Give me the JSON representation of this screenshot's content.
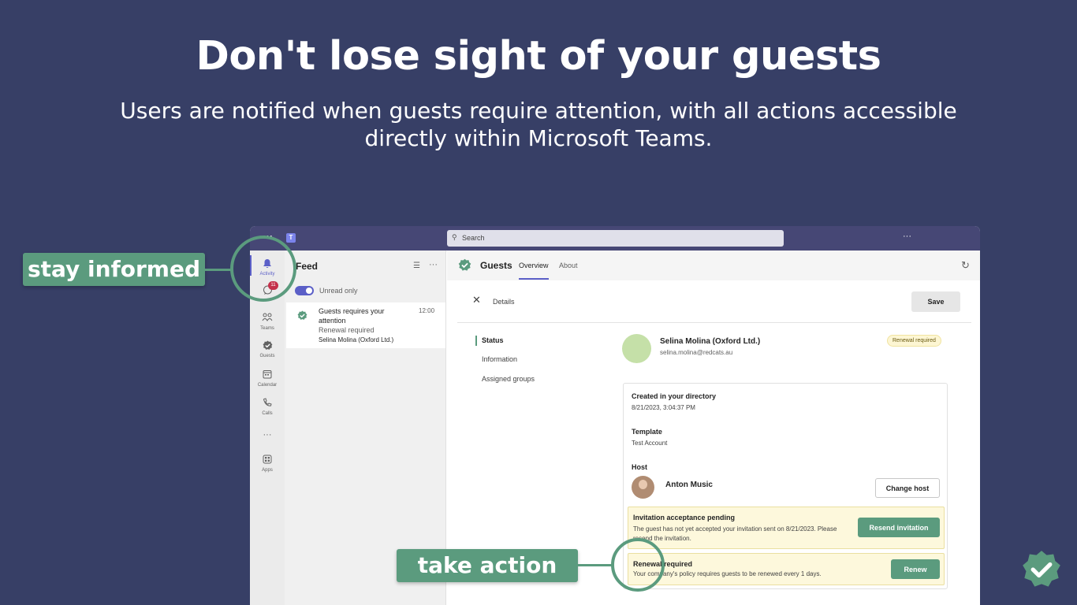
{
  "headline": "Don't lose sight of your guests",
  "subline": "Users are notified when guests require attention, with all actions accessible directly within Microsoft Teams.",
  "callouts": {
    "stay_informed": "stay informed",
    "take_action": "take action"
  },
  "titlebar": {
    "more_label": "⋯",
    "apps_dots": "⋯",
    "logo_text": "T",
    "search_placeholder": "Search",
    "search_icon": "search-icon",
    "overflow": "···"
  },
  "rail": {
    "items": [
      {
        "label": "Activity",
        "icon": "bell-icon"
      },
      {
        "label": "",
        "icon": "chat-icon",
        "badge": "11"
      },
      {
        "label": "Teams",
        "icon": "teams-icon"
      },
      {
        "label": "Guests",
        "icon": "guests-icon"
      },
      {
        "label": "Calendar",
        "icon": "calendar-icon"
      },
      {
        "label": "Calls",
        "icon": "phone-icon"
      },
      {
        "label": "···",
        "icon": "more-icon"
      },
      {
        "label": "Apps",
        "icon": "apps-icon"
      }
    ]
  },
  "feed": {
    "title": "Feed",
    "toggle_label": "Unread only",
    "card": {
      "title": "Guests requires your attention",
      "time": "12:00",
      "subtitle": "Renewal required",
      "name": "Selina Molina (Oxford Ltd.)"
    }
  },
  "app": {
    "name": "Guests",
    "tabs": [
      "Overview",
      "About"
    ],
    "details_label": "Details",
    "save_label": "Save",
    "nav": [
      "Status",
      "Information",
      "Assigned groups"
    ],
    "guest": {
      "name": "Selina Molina (Oxford Ltd.)",
      "email": "selina.molina@redcats.au",
      "status_badge": "Renewal required"
    },
    "card": {
      "created_label": "Created in your directory",
      "created_value": "8/21/2023, 3:04:37 PM",
      "template_label": "Template",
      "template_value": "Test Account",
      "host_label": "Host",
      "host_name": "Anton Music",
      "change_host": "Change host",
      "alert1_title": "Invitation acceptance pending",
      "alert1_desc": "The guest has not yet accepted your invitation sent on 8/21/2023. Please resend the invitation.",
      "alert1_button": "Resend invitation",
      "alert2_title": "Renewal required",
      "alert2_desc": "Your company's policy requires guests to be renewed every 1 days.",
      "alert2_button": "Renew"
    }
  },
  "colors": {
    "background": "#373f66",
    "accent_green": "#5b9b7e",
    "teams_purple": "#464775",
    "teams_accent": "#5b5fc7"
  }
}
